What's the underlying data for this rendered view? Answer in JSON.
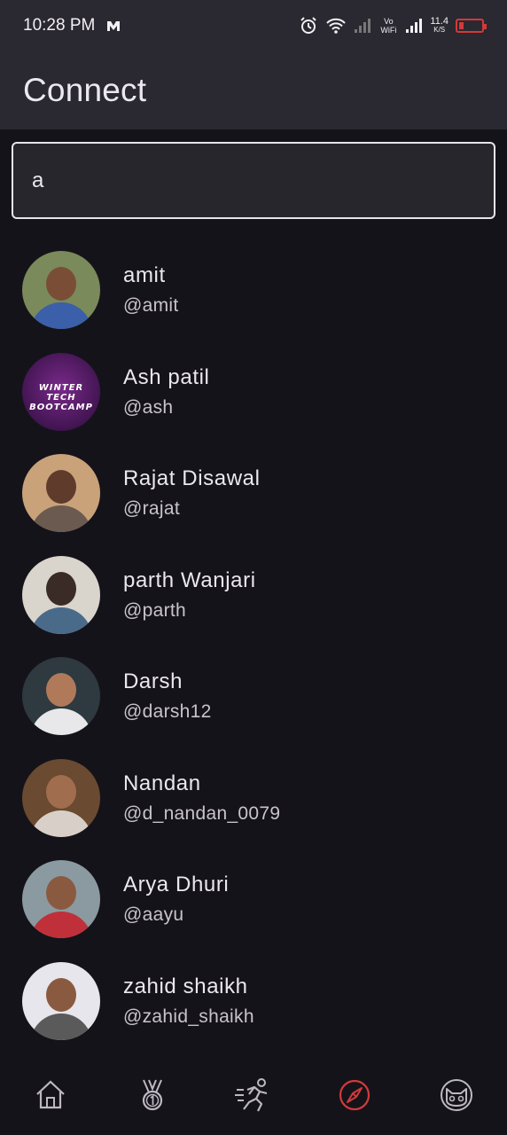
{
  "status": {
    "time": "10:28 PM",
    "net_speed_value": "11.4",
    "net_speed_unit": "K/S",
    "volte": "Vo WiFi"
  },
  "appbar": {
    "title": "Connect"
  },
  "search": {
    "value": "a"
  },
  "users": [
    {
      "name": "amit",
      "handle": "@amit",
      "bg": "#7a8a5a",
      "skin": "#7a4e36",
      "shirt": "#3b5fa8"
    },
    {
      "name": "Ash patil",
      "handle": "@ash",
      "bg": "#4a1a5e",
      "poster": "WINTER TECH BOOTCAMP"
    },
    {
      "name": "Rajat Disawal",
      "handle": "@rajat",
      "bg": "#c9a27a",
      "skin": "#5e3b2b",
      "shirt": "#6b5a50"
    },
    {
      "name": "parth Wanjari",
      "handle": "@parth",
      "bg": "#d9d4cc",
      "skin": "#3a2b26",
      "shirt": "#4a6a8a"
    },
    {
      "name": "Darsh",
      "handle": "@darsh12",
      "bg": "#2e3a40",
      "skin": "#b07a5a",
      "shirt": "#e8e8ea"
    },
    {
      "name": "Nandan",
      "handle": "@d_nandan_0079",
      "bg": "#6a4a30",
      "skin": "#a06e4e",
      "shirt": "#d8d0c8"
    },
    {
      "name": "Arya Dhuri",
      "handle": "@aayu",
      "bg": "#8a9aa0",
      "skin": "#8a5a40",
      "shirt": "#c0303a"
    },
    {
      "name": "zahid shaikh",
      "handle": "@zahid_shaikh",
      "bg": "#e6e6ec",
      "skin": "#8a5a40",
      "shirt": "#5a5a5a"
    }
  ],
  "nav": [
    {
      "icon": "home-icon",
      "active": false
    },
    {
      "icon": "medal-icon",
      "active": false
    },
    {
      "icon": "runner-icon",
      "active": false
    },
    {
      "icon": "compass-icon",
      "active": true
    },
    {
      "icon": "cat-icon",
      "active": false
    }
  ],
  "colors": {
    "accent": "#d23a3a",
    "background": "#15131a",
    "appbar": "#2a2830"
  }
}
